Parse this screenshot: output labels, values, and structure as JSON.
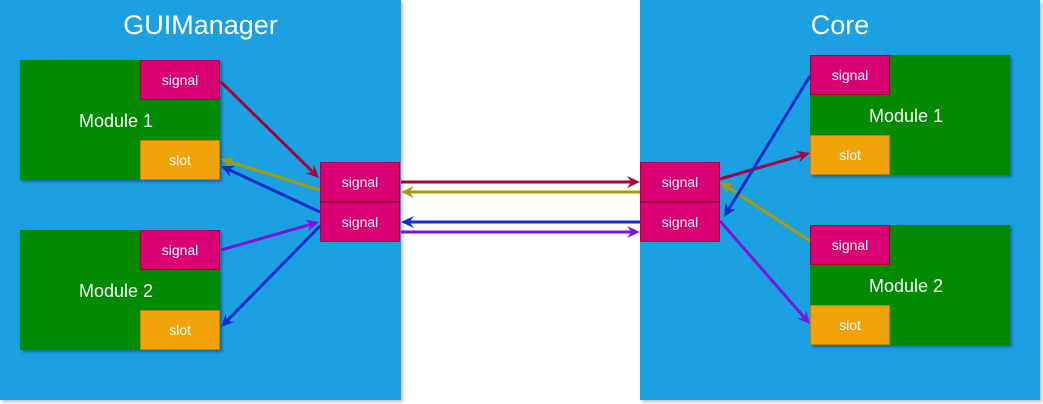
{
  "colors": {
    "panel": "#1ba1e2",
    "module": "#008a00",
    "signal": "#d80073",
    "slot": "#f0a30a",
    "arrow_crimson": "#a50040",
    "arrow_olive": "#a89a0a",
    "arrow_blue": "#0f2ec8",
    "arrow_purple": "#7a16d9"
  },
  "gui_manager": {
    "title": "GUIManager",
    "module1": {
      "label": "Module 1",
      "signal": "signal",
      "slot": "slot"
    },
    "module2": {
      "label": "Module 2",
      "signal": "signal",
      "slot": "slot"
    },
    "bus_signal_top": "signal",
    "bus_signal_bottom": "signal"
  },
  "core": {
    "title": "Core",
    "module1": {
      "label": "Module 1",
      "signal": "signal",
      "slot": "slot"
    },
    "module2": {
      "label": "Module 2",
      "signal": "signal",
      "slot": "slot"
    },
    "bus_signal_top": "signal",
    "bus_signal_bottom": "signal"
  },
  "connections": [
    {
      "name": "gui-m1-signal-to-gui-bus-top",
      "color": "arrow_crimson"
    },
    {
      "name": "gui-bus-top-to-gui-m1-slot",
      "color": "arrow_olive"
    },
    {
      "name": "gui-m2-signal-to-gui-bus-bottom",
      "color": "arrow_purple"
    },
    {
      "name": "gui-bus-bottom-to-gui-m1-slot",
      "color": "arrow_blue"
    },
    {
      "name": "gui-bus-bottom-to-gui-m2-slot",
      "color": "arrow_blue"
    },
    {
      "name": "gui-bus-top-to-core-bus-top",
      "color": "arrow_crimson"
    },
    {
      "name": "core-bus-top-to-gui-bus-top",
      "color": "arrow_olive"
    },
    {
      "name": "core-bus-bottom-to-gui-bus-bottom",
      "color": "arrow_blue"
    },
    {
      "name": "gui-bus-bottom-to-core-bus-bottom",
      "color": "arrow_purple"
    },
    {
      "name": "core-bus-top-to-core-m1-slot",
      "color": "arrow_crimson"
    },
    {
      "name": "core-m2-signal-to-core-bus-top",
      "color": "arrow_olive"
    },
    {
      "name": "core-m1-signal-to-core-bus-bottom",
      "color": "arrow_blue"
    },
    {
      "name": "core-bus-bottom-to-core-m2-slot",
      "color": "arrow_purple"
    }
  ]
}
